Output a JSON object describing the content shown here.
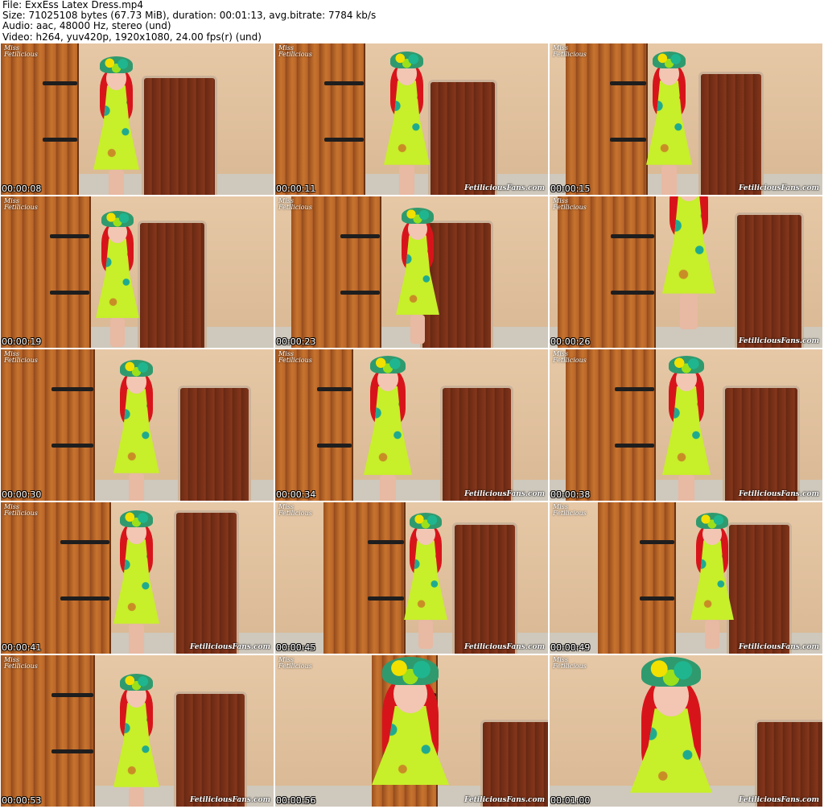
{
  "header": {
    "file_line": "File: ExxEss Latex Dress.mp4",
    "size_line": "Size: 71025108 bytes (67.73 MiB), duration: 00:01:13, avg.bitrate: 7784 kb/s",
    "audio_line": "Audio: aac, 48000 Hz, stereo (und)",
    "video_line": "Video: h264, yuv420p, 1920x1080, 24.00 fps(r) (und)"
  },
  "thumbnails": [
    {
      "timestamp": "00:00:08",
      "logo": "Miss\nFetilicious",
      "watermark": ""
    },
    {
      "timestamp": "00:00:11",
      "logo": "Miss\nFetilicious",
      "watermark": "FetiliciousFans.com"
    },
    {
      "timestamp": "00:00:15",
      "logo": "Miss\nFetilicious",
      "watermark": "FetiliciousFans.com"
    },
    {
      "timestamp": "00:00:19",
      "logo": "Miss\nFetilicious",
      "watermark": ""
    },
    {
      "timestamp": "00:00:23",
      "logo": "Miss\nFetilicious",
      "watermark": ""
    },
    {
      "timestamp": "00:00:26",
      "logo": "Miss\nFetilicious",
      "watermark": "FetiliciousFans.com"
    },
    {
      "timestamp": "00:00:30",
      "logo": "Miss\nFetilicious",
      "watermark": ""
    },
    {
      "timestamp": "00:00:34",
      "logo": "Miss\nFetilicious",
      "watermark": "FetiliciousFans.com"
    },
    {
      "timestamp": "00:00:38",
      "logo": "Miss\nFetilicious",
      "watermark": "FetiliciousFans.com"
    },
    {
      "timestamp": "00:00:41",
      "logo": "Miss\nFetilicious",
      "watermark": "FetiliciousFans.com"
    },
    {
      "timestamp": "00:00:45",
      "logo": "Miss\nFetilicious",
      "watermark": "FetiliciousFans.com"
    },
    {
      "timestamp": "00:00:49",
      "logo": "Miss\nFetilicious",
      "watermark": "FetiliciousFans.com"
    },
    {
      "timestamp": "00:00:53",
      "logo": "Miss\nFetilicious",
      "watermark": "FetiliciousFans.com"
    },
    {
      "timestamp": "00:00:56",
      "logo": "Miss\nFetilicious",
      "watermark": "FetiliciousFans.com"
    },
    {
      "timestamp": "00:01:00",
      "logo": "Miss\nFetilicious",
      "watermark": "FetiliciousFans.com"
    }
  ],
  "colors": {
    "wall": "#e6c8a6",
    "shutter_wood": "#c7742f",
    "door_wood": "#7a3219",
    "hair": "#d8141b",
    "dress": "#c7ef2a",
    "timestamp_text": "#ffffff"
  },
  "icons": {
    "logo": "miss-fetilicious-logo",
    "watermark": "site-watermark"
  }
}
